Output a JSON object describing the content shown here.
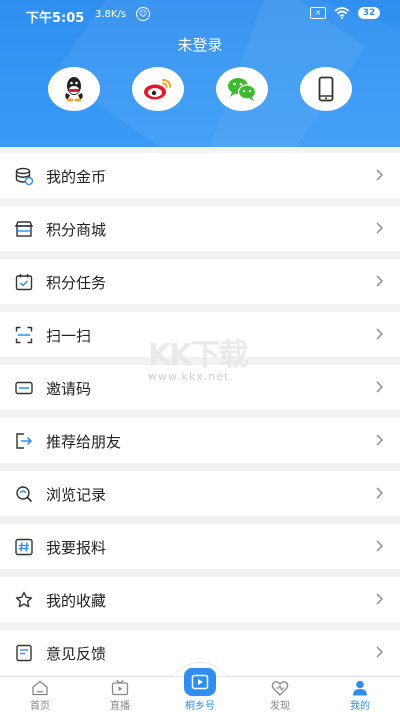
{
  "status_bar": {
    "time": "下午5:05",
    "speed": "3.8K/s",
    "battery": "32"
  },
  "header": {
    "login_status": "未登录",
    "login_options": [
      {
        "icon": "qq-icon"
      },
      {
        "icon": "weibo-icon"
      },
      {
        "icon": "wechat-icon"
      },
      {
        "icon": "phone-icon"
      }
    ]
  },
  "menu": {
    "items": [
      {
        "label": "我的金币",
        "icon": "coins-icon"
      },
      {
        "label": "积分商城",
        "icon": "store-icon"
      },
      {
        "label": "积分任务",
        "icon": "task-icon"
      },
      {
        "label": "扫一扫",
        "icon": "scan-icon"
      },
      {
        "label": "邀请码",
        "icon": "invite-code-icon"
      },
      {
        "label": "推荐给朋友",
        "icon": "share-icon"
      },
      {
        "label": "浏览记录",
        "icon": "history-icon"
      },
      {
        "label": "我要报料",
        "icon": "hashtag-icon"
      },
      {
        "label": "我的收藏",
        "icon": "star-icon"
      },
      {
        "label": "意见反馈",
        "icon": "feedback-icon"
      }
    ]
  },
  "watermark": {
    "brand": "KK下载",
    "url": "www.kkx.net"
  },
  "tab_bar": {
    "tabs": [
      {
        "label": "首页",
        "icon": "home-icon"
      },
      {
        "label": "直播",
        "icon": "live-icon"
      },
      {
        "label": "桐乡号",
        "icon": "tongxiang-icon"
      },
      {
        "label": "发现",
        "icon": "discover-icon"
      },
      {
        "label": "我的",
        "icon": "profile-icon"
      }
    ],
    "active": "我的"
  },
  "colors": {
    "primary": "#2f8ff0",
    "weibo": "#e6162d",
    "wechat": "#3dbb2f",
    "qq": "#222222"
  }
}
